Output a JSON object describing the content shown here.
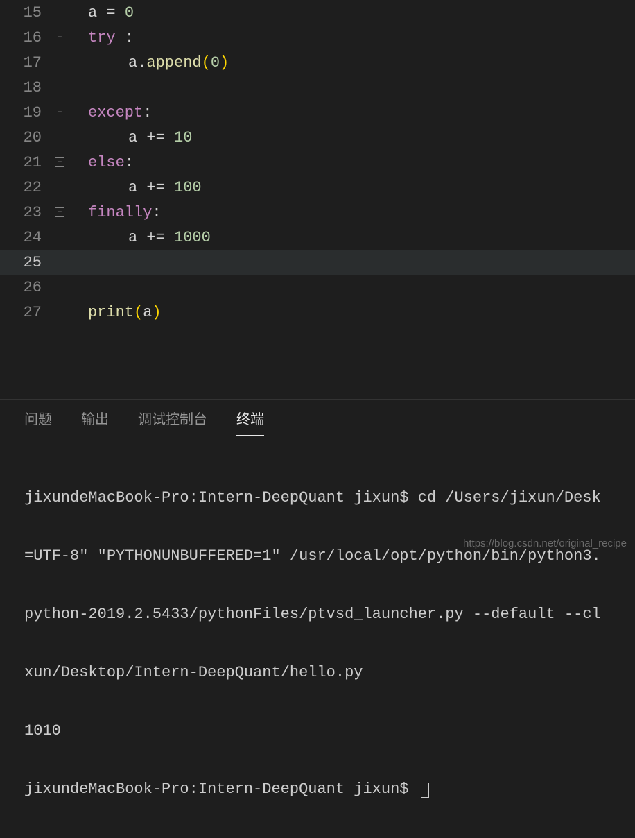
{
  "code": {
    "lines": [
      {
        "num": "15",
        "fold": false,
        "indent": 0,
        "guide": false
      },
      {
        "num": "16",
        "fold": true,
        "indent": 0,
        "guide": false
      },
      {
        "num": "17",
        "fold": false,
        "indent": 1,
        "guide": true
      },
      {
        "num": "18",
        "fold": false,
        "indent": 0,
        "guide": false
      },
      {
        "num": "19",
        "fold": true,
        "indent": 0,
        "guide": false
      },
      {
        "num": "20",
        "fold": false,
        "indent": 1,
        "guide": true
      },
      {
        "num": "21",
        "fold": true,
        "indent": 0,
        "guide": false
      },
      {
        "num": "22",
        "fold": false,
        "indent": 1,
        "guide": true
      },
      {
        "num": "23",
        "fold": true,
        "indent": 0,
        "guide": false
      },
      {
        "num": "24",
        "fold": false,
        "indent": 1,
        "guide": true
      },
      {
        "num": "25",
        "fold": false,
        "indent": 1,
        "guide": true,
        "highlighted": true
      },
      {
        "num": "26",
        "fold": false,
        "indent": 0,
        "guide": false
      },
      {
        "num": "27",
        "fold": false,
        "indent": 0,
        "guide": false
      }
    ],
    "tokens": {
      "l15_a": "a",
      "l15_eq": " = ",
      "l15_0": "0",
      "l16_try": "try",
      "l16_sp": " ",
      "l16_colon": ":",
      "l17_a": "a",
      "l17_dot": ".",
      "l17_append": "append",
      "l17_lp": "(",
      "l17_0": "0",
      "l17_rp": ")",
      "l19_except": "except",
      "l19_colon": ":",
      "l20_a": "a",
      "l20_pe": " += ",
      "l20_10": "10",
      "l21_else": "else",
      "l21_colon": ":",
      "l22_a": "a",
      "l22_pe": " += ",
      "l22_100": "100",
      "l23_finally": "finally",
      "l23_colon": ":",
      "l24_a": "a",
      "l24_pe": " += ",
      "l24_1000": "1000",
      "l27_print": "print",
      "l27_lp": "(",
      "l27_a": "a",
      "l27_rp": ")"
    },
    "fold_glyph": "−"
  },
  "panel": {
    "tabs": {
      "problems": "问题",
      "output": "输出",
      "debug_console": "调试控制台",
      "terminal": "终端"
    },
    "terminal_lines": {
      "t1": "jixundeMacBook-Pro:Intern-DeepQuant jixun$ cd /Users/jixun/Desk",
      "t2": "=UTF-8\" \"PYTHONUNBUFFERED=1\" /usr/local/opt/python/bin/python3.",
      "t3": "python-2019.2.5433/pythonFiles/ptvsd_launcher.py --default --cl",
      "t4": "xun/Desktop/Intern-DeepQuant/hello.py",
      "t5": "1010",
      "t6": "jixundeMacBook-Pro:Intern-DeepQuant jixun$ "
    }
  },
  "watermark": "https://blog.csdn.net/original_recipe"
}
